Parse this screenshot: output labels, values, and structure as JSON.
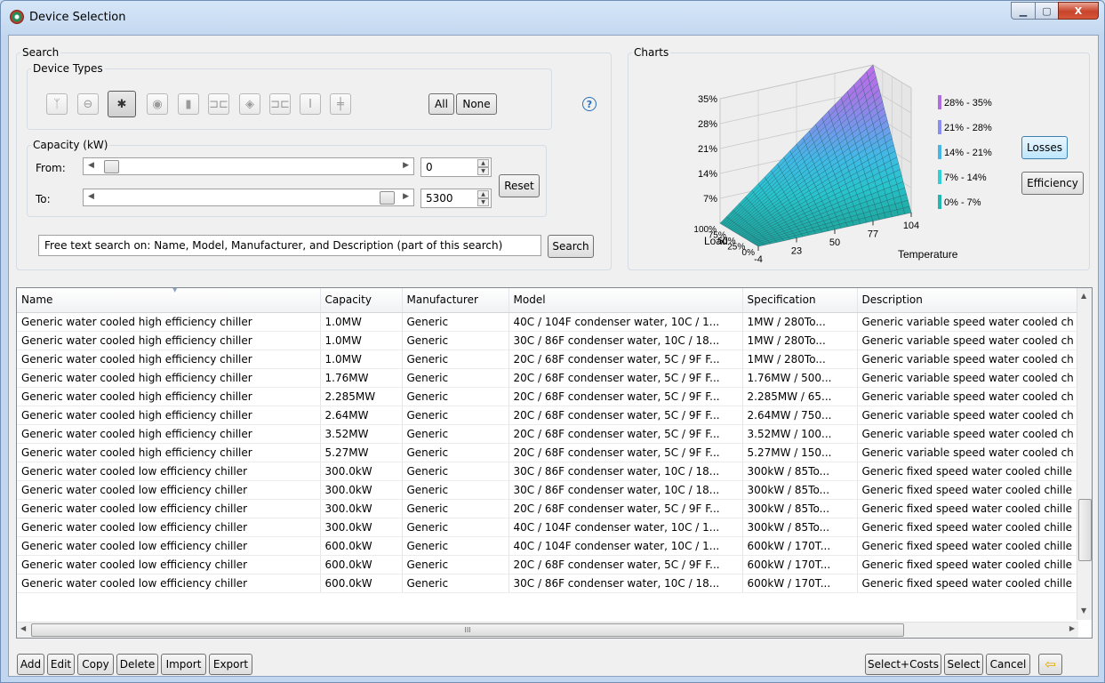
{
  "window": {
    "title": "Device Selection",
    "minimize_glyph": "▁",
    "maximize_glyph": "▢",
    "close_glyph": "X"
  },
  "search": {
    "group_label": "Search",
    "device_types_label": "Device Types",
    "device_type_icons": [
      "fan-icon",
      "pipe-icon",
      "chiller-icon",
      "pump-icon",
      "tank-icon",
      "valve-icon",
      "diamond-icon",
      "coil-icon",
      "column-icon",
      "cross-icon"
    ],
    "device_type_glyphs": [
      "ᛉ",
      "⊖",
      "✱",
      "◉",
      "▮",
      "⊐⊏",
      "◈",
      "⊐⊏",
      "Ⅰ",
      "╪"
    ],
    "all_label": "All",
    "none_label": "None",
    "help_glyph": "?",
    "capacity_label": "Capacity (kW)",
    "from_label": "From:",
    "to_label": "To:",
    "from_value": "0",
    "to_value": "5300",
    "reset_label": "Reset",
    "free_text": "Free text search on: Name, Model, Manufacturer, and Description (part of this search)",
    "search_label": "Search"
  },
  "charts": {
    "group_label": "Charts",
    "losses_button": "Losses",
    "efficiency_button": "Efficiency"
  },
  "chart_data": {
    "type": "surface3d",
    "title": "Losses",
    "xlabel": "Temperature",
    "ylabel": "Load",
    "x_ticks": [
      "-4",
      "23",
      "50",
      "77",
      "104"
    ],
    "y_ticks": [
      "0%",
      "25%",
      "50%",
      "75%",
      "100%"
    ],
    "z_ticks": [
      "7%",
      "14%",
      "21%",
      "28%",
      "35%"
    ],
    "legend": [
      {
        "label": "28% - 35%",
        "color": "#b06de0"
      },
      {
        "label": "21% - 28%",
        "color": "#8a8ef0"
      },
      {
        "label": "14% - 21%",
        "color": "#47b7e8"
      },
      {
        "label": "7% - 14%",
        "color": "#2fd0d8"
      },
      {
        "label": "0% - 7%",
        "color": "#20b8b0"
      }
    ]
  },
  "table": {
    "columns": [
      "Name",
      "Capacity",
      "Manufacturer",
      "Model",
      "Specification",
      "Description"
    ],
    "rows": [
      [
        "Generic water cooled high efficiency chiller",
        "1.0MW",
        "Generic",
        "40C / 104F condenser water, 10C / 1...",
        "1MW / 280To...",
        "Generic variable speed water cooled ch"
      ],
      [
        "Generic water cooled high efficiency chiller",
        "1.0MW",
        "Generic",
        "30C / 86F condenser water, 10C / 18...",
        "1MW / 280To...",
        "Generic variable speed water cooled ch"
      ],
      [
        "Generic water cooled high efficiency chiller",
        "1.0MW",
        "Generic",
        "20C / 68F condenser water, 5C / 9F F...",
        "1MW / 280To...",
        "Generic variable speed water cooled ch"
      ],
      [
        "Generic water cooled high efficiency chiller",
        "1.76MW",
        "Generic",
        "20C / 68F condenser water, 5C / 9F F...",
        "1.76MW / 500...",
        "Generic variable speed water cooled ch"
      ],
      [
        "Generic water cooled high efficiency chiller",
        "2.285MW",
        "Generic",
        "20C / 68F condenser water, 5C / 9F F...",
        "2.285MW / 65...",
        "Generic variable speed water cooled ch"
      ],
      [
        "Generic water cooled high efficiency chiller",
        "2.64MW",
        "Generic",
        "20C / 68F condenser water, 5C / 9F F...",
        "2.64MW / 750...",
        "Generic variable speed water cooled ch"
      ],
      [
        "Generic water cooled high efficiency chiller",
        "3.52MW",
        "Generic",
        "20C / 68F condenser water, 5C / 9F F...",
        "3.52MW / 100...",
        "Generic variable speed water cooled ch"
      ],
      [
        "Generic water cooled high efficiency chiller",
        "5.27MW",
        "Generic",
        "20C / 68F condenser water, 5C / 9F F...",
        "5.27MW / 150...",
        "Generic variable speed water cooled ch"
      ],
      [
        "Generic water cooled low efficiency chiller",
        "300.0kW",
        "Generic",
        "30C / 86F condenser water, 10C / 18...",
        "300kW / 85To...",
        "Generic fixed speed water cooled chille"
      ],
      [
        "Generic water cooled low efficiency chiller",
        "300.0kW",
        "Generic",
        "30C / 86F condenser water, 10C / 18...",
        "300kW / 85To...",
        "Generic fixed speed water cooled chille"
      ],
      [
        "Generic water cooled low efficiency chiller",
        "300.0kW",
        "Generic",
        "20C / 68F condenser water, 5C / 9F F...",
        "300kW / 85To...",
        "Generic fixed speed water cooled chille"
      ],
      [
        "Generic water cooled low efficiency chiller",
        "300.0kW",
        "Generic",
        "40C / 104F condenser water, 10C / 1...",
        "300kW / 85To...",
        "Generic fixed speed water cooled chille"
      ],
      [
        "Generic water cooled low efficiency chiller",
        "600.0kW",
        "Generic",
        "40C / 104F condenser water, 10C / 1...",
        "600kW / 170T...",
        "Generic fixed speed water cooled chille"
      ],
      [
        "Generic water cooled low efficiency chiller",
        "600.0kW",
        "Generic",
        "20C / 68F condenser water, 5C / 9F F...",
        "600kW / 170T...",
        "Generic fixed speed water cooled chille"
      ],
      [
        "Generic water cooled low efficiency chiller",
        "600.0kW",
        "Generic",
        "30C / 86F condenser water, 10C / 18...",
        "600kW / 170T...",
        "Generic fixed speed water cooled chille"
      ]
    ],
    "hscroll_grip": "III"
  },
  "footer": {
    "add": "Add",
    "edit": "Edit",
    "copy": "Copy",
    "delete": "Delete",
    "import": "Import",
    "export": "Export",
    "select_costs": "Select+Costs",
    "select": "Select",
    "cancel": "Cancel",
    "back_glyph": "⇦"
  }
}
